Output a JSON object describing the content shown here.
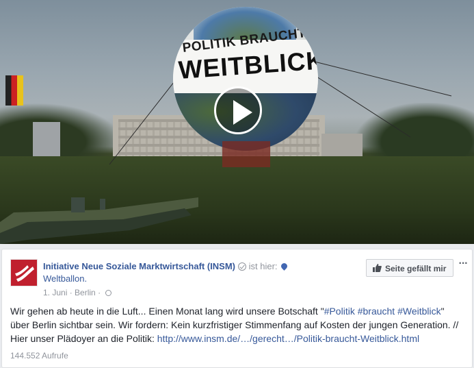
{
  "video": {
    "balloon_line1": "POLITIK BRAUCHT",
    "balloon_line2": "WEITBLICK. in",
    "play_icon": "play-icon"
  },
  "post": {
    "page_name": "Initiative Neue Soziale Marktwirtschaft (INSM)",
    "checkin_prefix": "ist hier:",
    "location": "Weltballon.",
    "date": "1. Juni",
    "separator": "·",
    "city": "Berlin",
    "separator2": "·",
    "like_button_label": "Seite gefällt mir",
    "more_label": "···",
    "text_part1": "Wir gehen ab heute in die Luft... Einen Monat lang wird unsere Botschaft \"",
    "hashtag1": "#Politik",
    "hashtag2": "#braucht",
    "hashtag3": "#Weitblick",
    "text_part2": "\" über Berlin sichtbar sein. Wir fordern: Kein kurzfristiger Stimmenfang auf Kosten der jungen Generation. // Hier unser Plädoyer an die Politik: ",
    "link": "http://www.insm.de/…/gerecht…/Politik-braucht-Weitblick.html",
    "views": "144.552 Aufrufe"
  },
  "colors": {
    "link": "#365899",
    "muted": "#90949c",
    "avatar_bg": "#c0202e"
  }
}
